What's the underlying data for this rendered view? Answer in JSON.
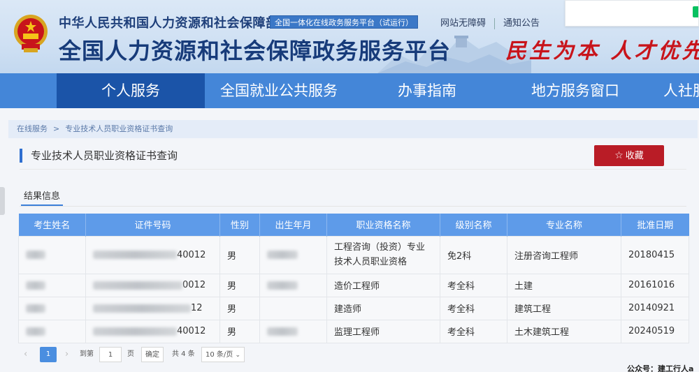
{
  "header": {
    "ministry_name": "中华人民共和国人力资源和社会保障部",
    "platform_tag": "全国一体化在线政务服务平台（试运行）",
    "platform_title": "全国人力资源和社会保障政务服务平台",
    "slogan": "民生为本 人才优先",
    "links": [
      "网站无障碍",
      "通知公告"
    ]
  },
  "nav": {
    "items": [
      "个人服务",
      "全国就业公共服务",
      "办事指南",
      "地方服务窗口",
      "人社服"
    ],
    "active_index": 0
  },
  "breadcrumb": {
    "home": "在线服务",
    "separator": ">",
    "current": "专业技术人员职业资格证书查询"
  },
  "page": {
    "title": "专业技术人员职业资格证书查询",
    "favorite_label": "收藏"
  },
  "tab": {
    "label": "结果信息"
  },
  "table": {
    "columns": [
      "考生姓名",
      "证件号码",
      "性别",
      "出生年月",
      "职业资格名称",
      "级别名称",
      "专业名称",
      "批准日期"
    ],
    "rows": [
      {
        "id_tail": "40012",
        "gender": "男",
        "qualification": "工程咨询（投资）专业技术人员职业资格",
        "level": "免2科",
        "major": "注册咨询工程师",
        "date": "20180415"
      },
      {
        "id_tail": "0012",
        "gender": "男",
        "qualification": "造价工程师",
        "level": "考全科",
        "major": "土建",
        "date": "20161016"
      },
      {
        "id_tail": "12",
        "gender": "男",
        "qualification": "建造师",
        "level": "考全科",
        "major": "建筑工程",
        "date": "20140921"
      },
      {
        "id_tail": "40012",
        "gender": "男",
        "qualification": "监理工程师",
        "level": "考全科",
        "major": "土木建筑工程",
        "date": "20240519"
      }
    ]
  },
  "pagination": {
    "current_page": "1",
    "goto_label": "到第",
    "page_input": "1",
    "page_unit": "页",
    "confirm_label": "确定",
    "total_label": "共 4 条",
    "page_size_label": "10 条/页"
  },
  "watermark": "公众号：建工行人a",
  "colors": {
    "nav_bg": "#4486d8",
    "nav_active": "#1b54a8",
    "table_header": "#5e9be9",
    "favorite_button": "#b91c26",
    "slogan": "#c8141b"
  }
}
